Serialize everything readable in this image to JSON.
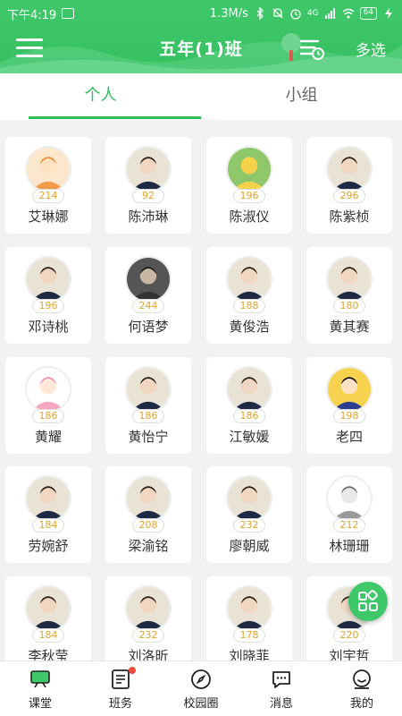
{
  "status_bar": {
    "time": "下午4:19",
    "speed": "1.3M/s",
    "network": "4G",
    "battery": "64"
  },
  "header": {
    "title": "五年(1)班",
    "multi_select": "多选"
  },
  "tabs": [
    {
      "label": "个人",
      "active": true
    },
    {
      "label": "小组",
      "active": false
    }
  ],
  "students": [
    {
      "name": "艾琳娜",
      "score": "214",
      "avatar": "cartoon-orange"
    },
    {
      "name": "陈沛琳",
      "score": "92",
      "avatar": "photo"
    },
    {
      "name": "陈淑仪",
      "score": "196",
      "avatar": "cartoon-duck"
    },
    {
      "name": "陈紫桢",
      "score": "296",
      "avatar": "photo"
    },
    {
      "name": "邓诗桃",
      "score": "196",
      "avatar": "photo"
    },
    {
      "name": "何语梦",
      "score": "244",
      "avatar": "photo-dark"
    },
    {
      "name": "黄俊浩",
      "score": "188",
      "avatar": "photo"
    },
    {
      "name": "黄其赛",
      "score": "180",
      "avatar": "photo"
    },
    {
      "name": "黄耀",
      "score": "186",
      "avatar": "cartoon-pink"
    },
    {
      "name": "黄怡宁",
      "score": "186",
      "avatar": "photo"
    },
    {
      "name": "江敏媛",
      "score": "186",
      "avatar": "photo"
    },
    {
      "name": "老四",
      "score": "198",
      "avatar": "cartoon-police"
    },
    {
      "name": "劳婉舒",
      "score": "184",
      "avatar": "photo"
    },
    {
      "name": "梁渝铭",
      "score": "208",
      "avatar": "photo"
    },
    {
      "name": "廖朝威",
      "score": "232",
      "avatar": "photo"
    },
    {
      "name": "林珊珊",
      "score": "212",
      "avatar": "cartoon-totoro"
    },
    {
      "name": "李秋莹",
      "score": "184",
      "avatar": "photo"
    },
    {
      "name": "刘洛昕",
      "score": "232",
      "avatar": "photo"
    },
    {
      "name": "刘晓菲",
      "score": "178",
      "avatar": "photo"
    },
    {
      "name": "刘宇哲",
      "score": "220",
      "avatar": "photo"
    }
  ],
  "bottom_nav": [
    {
      "label": "课堂",
      "icon": "classroom-icon",
      "active": true
    },
    {
      "label": "班务",
      "icon": "class-affairs-icon",
      "badge": true
    },
    {
      "label": "校园圈",
      "icon": "compass-icon"
    },
    {
      "label": "消息",
      "icon": "message-icon"
    },
    {
      "label": "我的",
      "icon": "profile-icon"
    }
  ],
  "colors": {
    "primary": "#3fc86a",
    "score": "#e2a32a",
    "badge": "#f04a3a"
  }
}
